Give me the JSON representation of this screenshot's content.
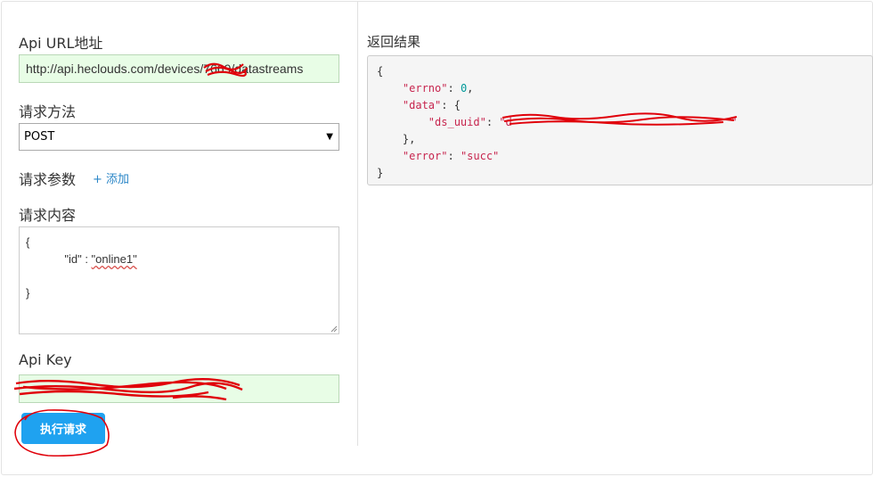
{
  "form": {
    "url_label": "Api URL地址",
    "url_value_prefix": "http://api.heclouds.com/devices/",
    "url_value_redacted": "7669",
    "url_value_suffix": "/datastreams",
    "method_label": "请求方法",
    "method_selected": "POST",
    "params_label": "请求参数",
    "add_param_label": "+ 添加",
    "body_label": "请求内容",
    "body_line1": "{",
    "body_key": "\"id\"",
    "body_sep": " : ",
    "body_value": "\"online1\"",
    "body_line3": "}",
    "api_key_label": "Api Key",
    "execute_label": "执行请求"
  },
  "result": {
    "label": "返回结果",
    "errno_key": "\"errno\"",
    "errno_value": "0",
    "data_key": "\"data\"",
    "ds_uuid_key": "\"ds_uuid\"",
    "ds_uuid_value_visible": "\"d",
    "ds_uuid_value_end": "\"",
    "error_key": "\"error\"",
    "error_value": "\"succ\""
  },
  "colors": {
    "accent_button": "#1fa2f0",
    "link": "#2a86c7",
    "input_highlight": "#e8fde6",
    "redaction": "#e0000a"
  }
}
